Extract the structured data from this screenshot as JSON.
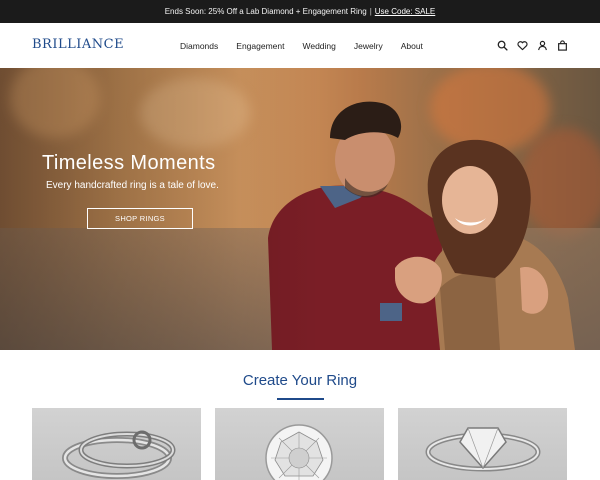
{
  "promo": {
    "text": "Ends Soon: 25% Off a Lab Diamond + Engagement Ring",
    "separator": "|",
    "link": "Use Code: SALE"
  },
  "header": {
    "logo": "BRILLIANCE",
    "nav": [
      "Diamonds",
      "Engagement",
      "Wedding",
      "Jewelry",
      "About"
    ],
    "icons": [
      "search-icon",
      "heart-icon",
      "user-icon",
      "bag-icon"
    ]
  },
  "hero": {
    "title": "Timeless Moments",
    "subtitle": "Every handcrafted ring is a tale of love.",
    "button": "SHOP RINGS"
  },
  "section": {
    "title": "Create Your Ring",
    "cards": [
      "engagement-ring-setting",
      "loose-diamond",
      "complete-ring"
    ]
  },
  "colors": {
    "brand": "#1f4a8a",
    "promo_bg": "#1b1b1b"
  }
}
